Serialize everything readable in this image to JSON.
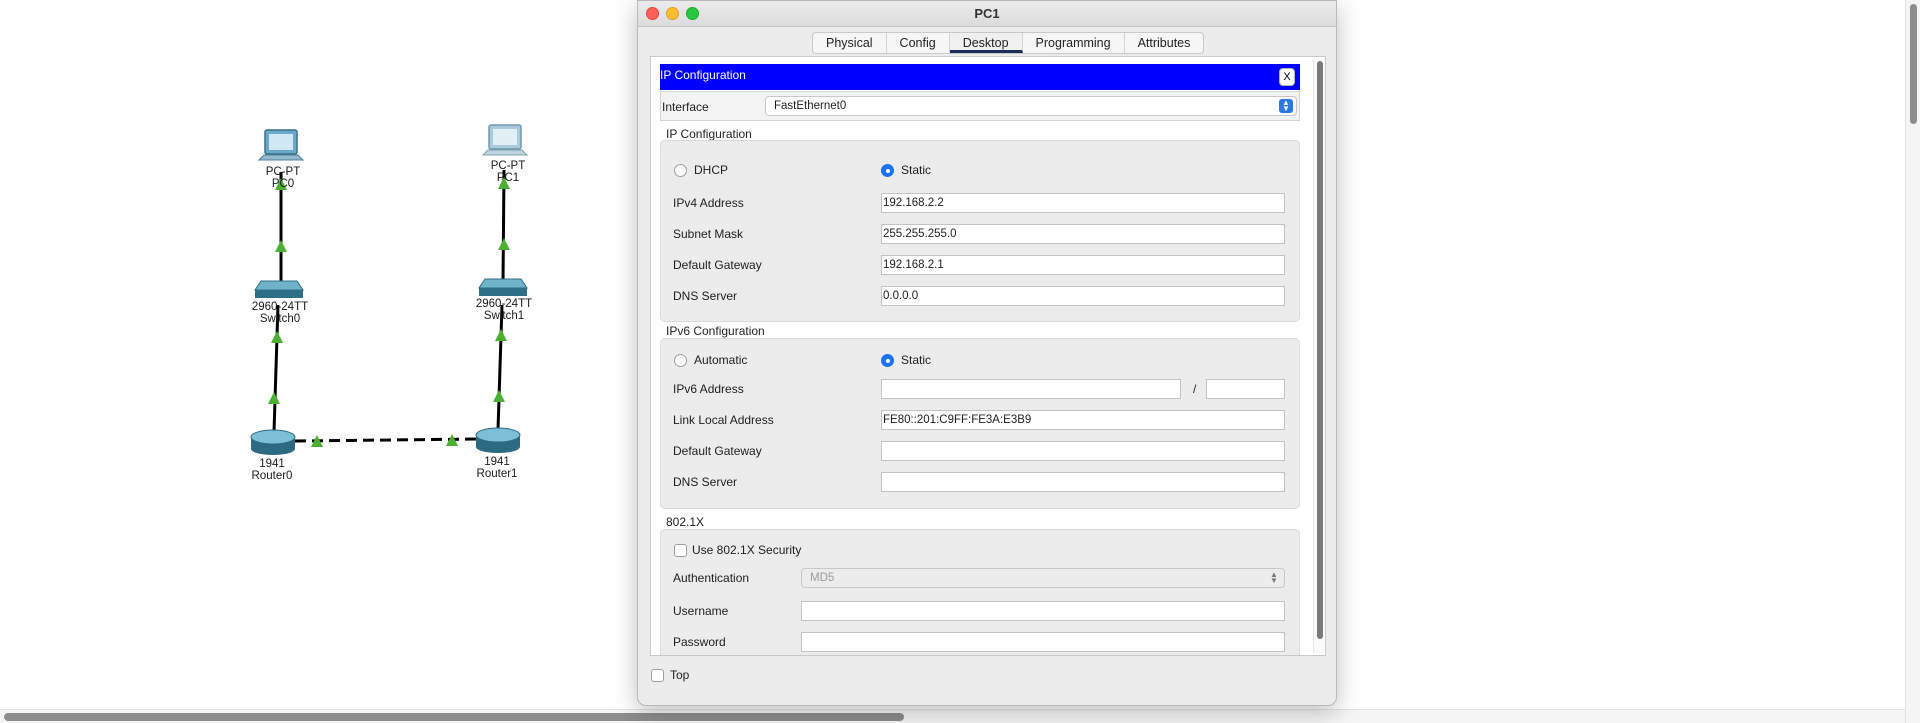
{
  "topology": {
    "devices": [
      {
        "name": "PC0",
        "model": "PC-PT",
        "kind": "pc"
      },
      {
        "name": "PC1",
        "model": "PC-PT",
        "kind": "pc"
      },
      {
        "name": "Switch0",
        "model": "2960-24TT",
        "kind": "switch"
      },
      {
        "name": "Switch1",
        "model": "2960-24TT",
        "kind": "switch"
      },
      {
        "name": "Router0",
        "model": "1941",
        "kind": "router"
      },
      {
        "name": "Router1",
        "model": "1941",
        "kind": "router"
      }
    ],
    "link_color": "#000000",
    "link_status_color": "#4caf31"
  },
  "window": {
    "title": "PC1",
    "tabs": [
      "Physical",
      "Config",
      "Desktop",
      "Programming",
      "Attributes"
    ],
    "active_tab": "Desktop",
    "header": {
      "title": "IP Configuration",
      "close": "X",
      "color": "#0000ff"
    },
    "interface": {
      "label": "Interface",
      "value": "FastEthernet0"
    },
    "ipv4": {
      "title": "IP Configuration",
      "dhcp_label": "DHCP",
      "static_label": "Static",
      "mode": "Static",
      "address_label": "IPv4 Address",
      "address": "192.168.2.2",
      "mask_label": "Subnet Mask",
      "mask": "255.255.255.0",
      "gateway_label": "Default Gateway",
      "gateway": "192.168.2.1",
      "dns_label": "DNS Server",
      "dns": "0.0.0.0"
    },
    "ipv6": {
      "title": "IPv6 Configuration",
      "auto_label": "Automatic",
      "static_label": "Static",
      "mode": "Static",
      "address_label": "IPv6 Address",
      "address": "",
      "slash": "/",
      "prefix": "",
      "link_local_label": "Link Local Address",
      "link_local": "FE80::201:C9FF:FE3A:E3B9",
      "gateway_label": "Default Gateway",
      "gateway": "",
      "dns_label": "DNS Server",
      "dns": ""
    },
    "dot1x": {
      "title": "802.1X",
      "use_label": "Use 802.1X Security",
      "use": false,
      "auth_label": "Authentication",
      "auth_value": "MD5",
      "user_label": "Username",
      "username": "",
      "pass_label": "Password",
      "password": ""
    },
    "top": {
      "label": "Top",
      "checked": false
    }
  }
}
